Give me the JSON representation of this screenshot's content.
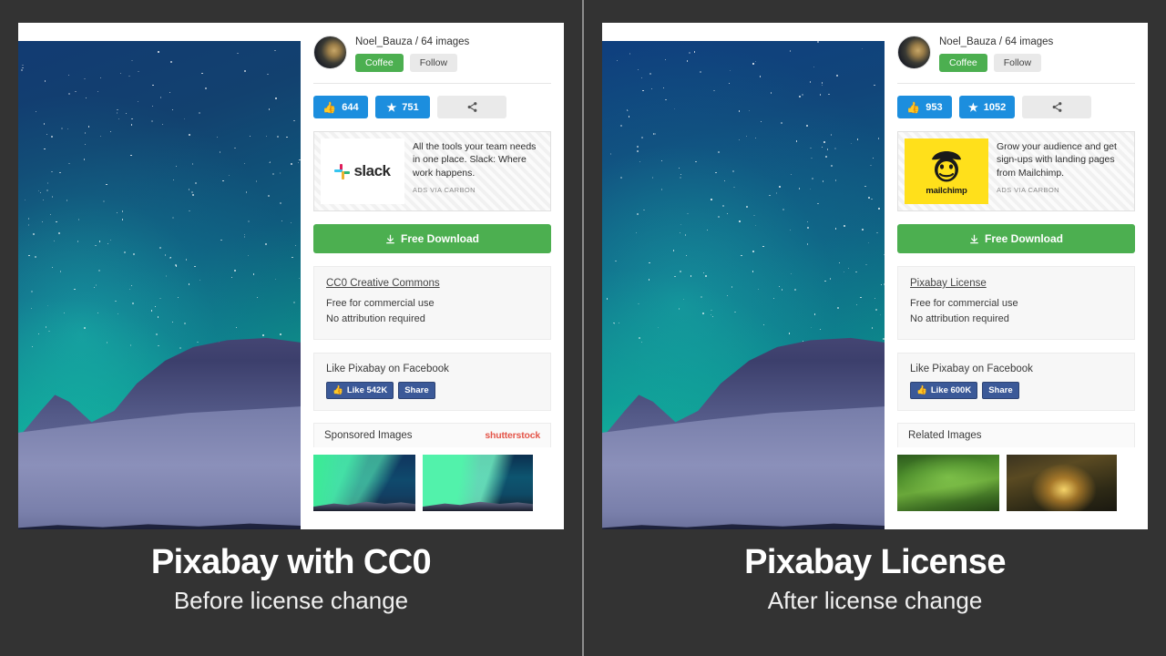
{
  "background_color": "#333333",
  "divider_color": "#8c8c8c",
  "panels": [
    {
      "id": "before",
      "photo": {
        "alt": "aurora borealis over snowy mountains",
        "scene": "aurora-night-mountains"
      },
      "user": {
        "name_line": "Noel_Bauza / 64 images",
        "coffee_label": "Coffee",
        "follow_label": "Follow",
        "avatar_icon": "user-avatar"
      },
      "stats": {
        "like_icon": "thumbs-up-icon",
        "like_count": "644",
        "star_icon": "star-icon",
        "star_count": "751",
        "share_icon": "share-icon"
      },
      "ad": {
        "brand": "slack",
        "logo_icon": "slack-logo-icon",
        "text": "All the tools your team needs in one place. Slack: Where work happens.",
        "via": "ADS VIA CARBON"
      },
      "download": {
        "icon": "download-icon",
        "label": "Free Download"
      },
      "license": {
        "title": "CC0 Creative Commons",
        "line1": "Free for commercial use",
        "line2": "No attribution required"
      },
      "facebook": {
        "title": "Like Pixabay on Facebook",
        "like_icon": "facebook-thumbs-up-icon",
        "like_label": "Like 542K",
        "share_label": "Share"
      },
      "related": {
        "title": "Sponsored Images",
        "partner_logo": "shutterstock",
        "partner_logo_icon": "shutterstock-logo-icon",
        "thumbs": [
          {
            "name": "aurora-thumbnail-1",
            "style": "aurora-a"
          },
          {
            "name": "aurora-thumbnail-2",
            "style": "aurora-b"
          }
        ]
      },
      "caption": {
        "title": "Pixabay with CC0",
        "subtitle": "Before license change"
      }
    },
    {
      "id": "after",
      "photo": {
        "alt": "aurora borealis over snowy mountains",
        "scene": "aurora-night-mountains"
      },
      "user": {
        "name_line": "Noel_Bauza / 64 images",
        "coffee_label": "Coffee",
        "follow_label": "Follow",
        "avatar_icon": "user-avatar"
      },
      "stats": {
        "like_icon": "thumbs-up-icon",
        "like_count": "953",
        "star_icon": "star-icon",
        "star_count": "1052",
        "share_icon": "share-icon"
      },
      "ad": {
        "brand": "mailchimp",
        "logo_icon": "mailchimp-logo-icon",
        "text": "Grow your audience and get sign-ups with landing pages from Mailchimp.",
        "via": "ADS VIA CARBON"
      },
      "download": {
        "icon": "download-icon",
        "label": "Free Download"
      },
      "license": {
        "title": "Pixabay License",
        "line1": "Free for commercial use",
        "line2": "No attribution required"
      },
      "facebook": {
        "title": "Like Pixabay on Facebook",
        "like_icon": "facebook-thumbs-up-icon",
        "like_label": "Like 600K",
        "share_label": "Share"
      },
      "related": {
        "title": "Related Images",
        "partner_logo": "",
        "partner_logo_icon": "",
        "thumbs": [
          {
            "name": "forest-thumbnail-1",
            "style": "forest-a"
          },
          {
            "name": "forest-thumbnail-2",
            "style": "forest-b"
          }
        ]
      },
      "caption": {
        "title": "Pixabay License",
        "subtitle": "After license change"
      }
    }
  ],
  "colors": {
    "accent_blue": "#1c8ede",
    "accent_green": "#4caf50",
    "facebook_blue": "#3b5998",
    "mailchimp_yellow": "#ffe01b",
    "shutterstock_red": "#e4564a"
  }
}
